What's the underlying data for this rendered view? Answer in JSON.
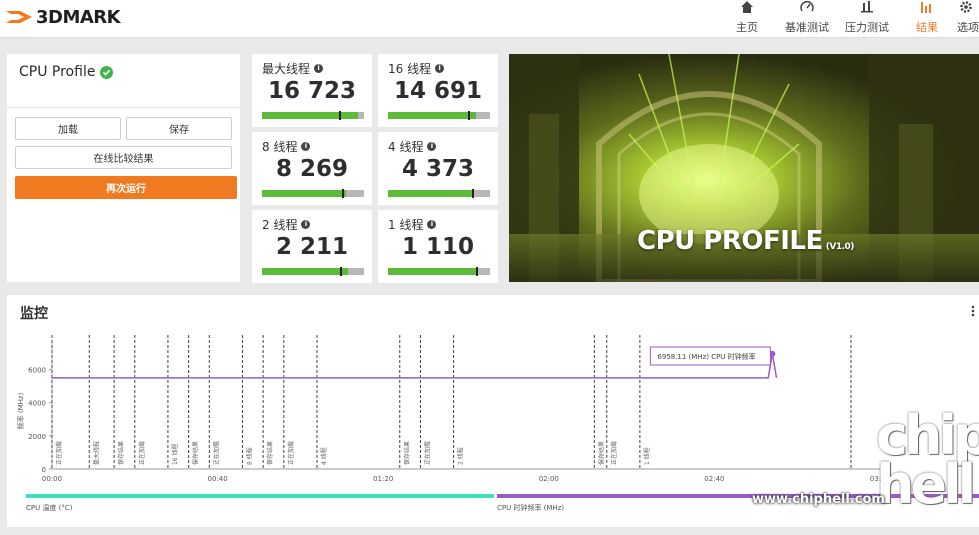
{
  "app": {
    "logo_text": "3DMARK"
  },
  "nav": [
    {
      "label": "主页",
      "icon": "home-icon"
    },
    {
      "label": "基准测试",
      "icon": "gauge-icon"
    },
    {
      "label": "压力测试",
      "icon": "stress-chart-icon"
    },
    {
      "label": "结果",
      "icon": "results-bar-icon",
      "active": true
    },
    {
      "label": "选项",
      "icon": "gear-icon"
    }
  ],
  "left": {
    "title": "CPU Profile",
    "load_label": "加载",
    "save_label": "保存",
    "compare_label": "在线比较结果",
    "run_label": "再次运行"
  },
  "scores": [
    {
      "label": "最大线程",
      "value": "16 723",
      "fill": 0.94,
      "marker": 0.75
    },
    {
      "label": "16 线程",
      "value": "14 691",
      "fill": 0.86,
      "marker": 0.78
    },
    {
      "label": "8 线程",
      "value": "8 269",
      "fill": 0.82,
      "marker": 0.78
    },
    {
      "label": "4 线程",
      "value": "4 373",
      "fill": 0.84,
      "marker": 0.82
    },
    {
      "label": "2 线程",
      "value": "2 211",
      "fill": 0.84,
      "marker": 0.76
    },
    {
      "label": "1 线程",
      "value": "1 110",
      "fill": 0.86,
      "marker": 0.86
    }
  ],
  "hero": {
    "title": "CPU PROFILE",
    "version": "(V1.0)"
  },
  "monitor": {
    "title": "监控",
    "tooltip": "6958.11 (MHz) CPU 时钟频率",
    "legend_temp": "CPU 温度 (°C)",
    "legend_clock": "CPU 时钟频率 (MHz)"
  },
  "chart_data": {
    "type": "line",
    "ylabel": "频率 (MHz)",
    "ylim": [
      0,
      7000
    ],
    "yticks": [
      "0",
      "2000",
      "4000",
      "6000"
    ],
    "xticks": [
      "00:00",
      "00:40",
      "01:20",
      "02:00",
      "02:40",
      "03:20"
    ],
    "xlim_seconds": [
      0,
      200
    ],
    "series": [
      {
        "name": "CPU 时钟频率 (MHz)",
        "color": "#9a5ac8",
        "points": [
          [
            0,
            5500
          ],
          [
            170,
            5500
          ],
          [
            173,
            5500
          ],
          [
            174,
            6958.11
          ],
          [
            175,
            5500
          ],
          [
            380,
            5500
          ]
        ]
      }
    ],
    "markers": [
      {
        "t": 0,
        "label": "正在加载"
      },
      {
        "t": 9,
        "label": "最大线程"
      },
      {
        "t": 15,
        "label": "保存结果"
      },
      {
        "t": 20,
        "label": "正在加载"
      },
      {
        "t": 28,
        "label": "16 线程"
      },
      {
        "t": 33,
        "label": "保存结果"
      },
      {
        "t": 38,
        "label": "正在加载"
      },
      {
        "t": 46,
        "label": "8 线程"
      },
      {
        "t": 51,
        "label": "保存结果"
      },
      {
        "t": 56,
        "label": "正在加载"
      },
      {
        "t": 64,
        "label": "4 线程"
      },
      {
        "t": 84,
        "label": "保存结果"
      },
      {
        "t": 89,
        "label": "正在加载"
      },
      {
        "t": 97,
        "label": "2 线程"
      },
      {
        "t": 131,
        "label": "保存结果"
      },
      {
        "t": 134,
        "label": "正在加载"
      },
      {
        "t": 142,
        "label": "1 线程"
      },
      {
        "t": 193,
        "label": ""
      }
    ]
  }
}
